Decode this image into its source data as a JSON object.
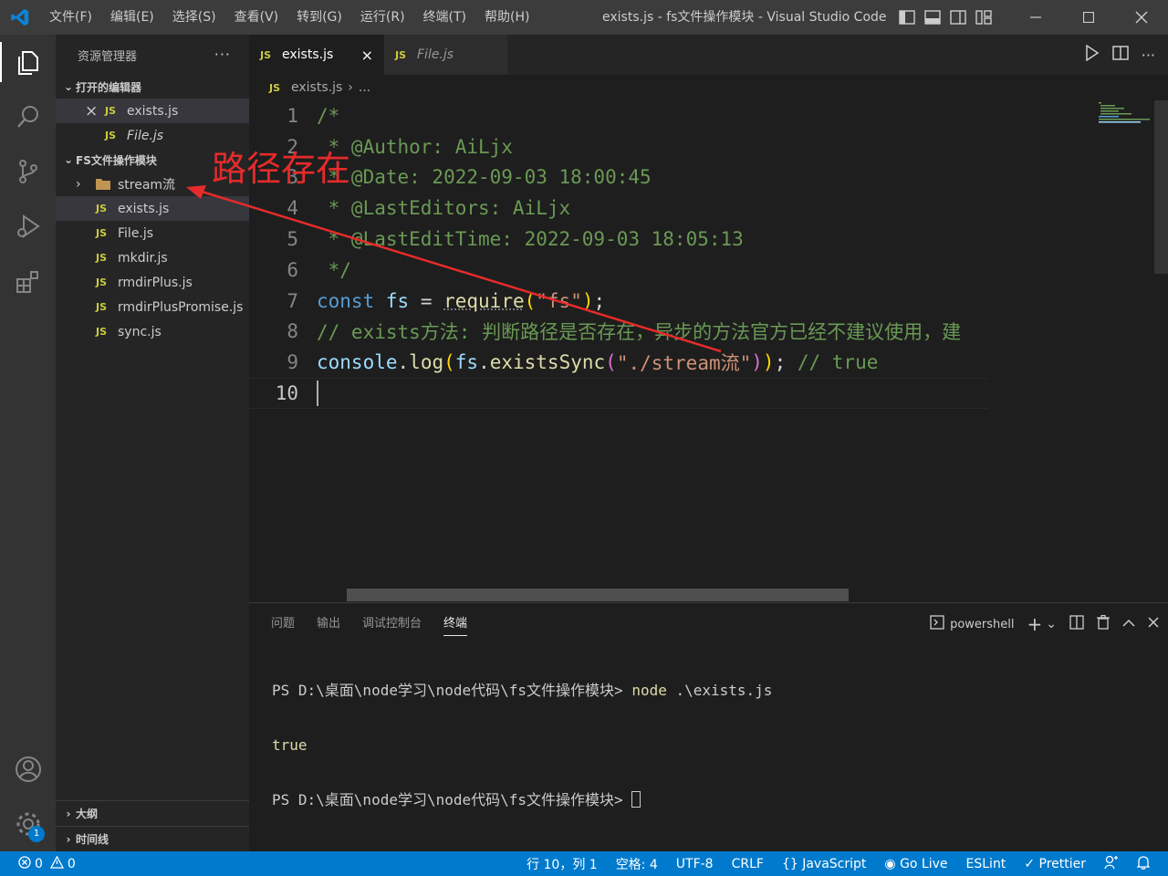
{
  "window": {
    "title": "exists.js - fs文件操作模块 - Visual Studio Code",
    "menu": [
      "文件(F)",
      "编辑(E)",
      "选择(S)",
      "查看(V)",
      "转到(G)",
      "运行(R)",
      "终端(T)",
      "帮助(H)"
    ]
  },
  "sidebar": {
    "header": "资源管理器",
    "more": "···",
    "open_editors_title": "打开的编辑器",
    "open_editors": [
      {
        "name": "exists.js",
        "close": "×"
      },
      {
        "name": "File.js"
      }
    ],
    "folder_title": "FS文件操作模块",
    "files": [
      {
        "name": "stream流",
        "type": "folder"
      },
      {
        "name": "exists.js",
        "type": "js"
      },
      {
        "name": "File.js",
        "type": "js"
      },
      {
        "name": "mkdir.js",
        "type": "js"
      },
      {
        "name": "rmdirPlus.js",
        "type": "js"
      },
      {
        "name": "rmdirPlusPromise.js",
        "type": "js"
      },
      {
        "name": "sync.js",
        "type": "js"
      }
    ],
    "outline_title": "大纲",
    "timeline_title": "时间线",
    "js_badge": "JS"
  },
  "editor": {
    "tabs": [
      {
        "label": "exists.js",
        "active": true
      },
      {
        "label": "File.js",
        "active": false
      }
    ],
    "breadcrumb": [
      "exists.js",
      "..."
    ],
    "line_numbers": [
      "1",
      "2",
      "3",
      "4",
      "5",
      "6",
      "7",
      "8",
      "9",
      "10"
    ],
    "code": {
      "l1": "/*",
      "l2": " * @Author: AiLjx",
      "l3": " * @Date: 2022-09-03 18:00:45",
      "l4": " * @LastEditors: AiLjx",
      "l5": " * @LastEditTime: 2022-09-03 18:05:13",
      "l6": " */",
      "l7_kw": "const",
      "l7_var": "fs",
      "l7_eq": " = ",
      "l7_fn": "require",
      "l7_str": "\"fs\"",
      "l8": "// exists方法: 判断路径是否存在，异步的方法官方已经不建议使用，建",
      "l9_obj": "console",
      "l9_fn": "log",
      "l9_fs": "fs",
      "l9_fn2": "existsSync",
      "l9_str": "\"./stream流\"",
      "l9_com": "// true"
    }
  },
  "annotation": {
    "text": "路径存在",
    "color": "#e52b2b"
  },
  "panel": {
    "tabs": [
      "问题",
      "输出",
      "调试控制台",
      "终端"
    ],
    "active_tab": "终端",
    "shell": "powershell",
    "terminal": {
      "prompt": "PS D:\\桌面\\node学习\\node代码\\fs文件操作模块>",
      "command": "node",
      "command_arg": " .\\exists.js",
      "output": "true"
    }
  },
  "statusbar": {
    "errors": "0",
    "warnings": "0",
    "position": "行 10，列 1",
    "spaces": "空格: 4",
    "encoding": "UTF-8",
    "eol": "CRLF",
    "language": "JavaScript",
    "golive": "Go Live",
    "eslint": "ESLint",
    "prettier": "Prettier",
    "settings_badge": "1"
  },
  "colors": {
    "accent": "#007acc",
    "js_yellow": "#cbcb41",
    "comment": "#6a9955",
    "keyword": "#569cd6"
  },
  "icons": [
    "vscode-logo-icon",
    "explorer-icon",
    "search-icon",
    "source-control-icon",
    "run-debug-icon",
    "extensions-icon",
    "account-icon",
    "settings-gear-icon",
    "folder-icon",
    "run-icon",
    "split-editor-icon"
  ]
}
